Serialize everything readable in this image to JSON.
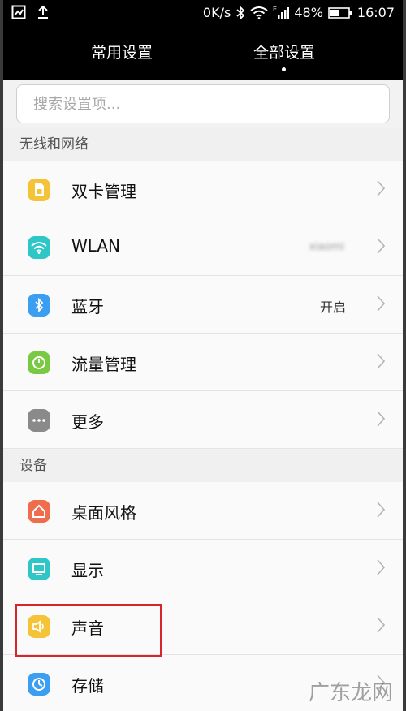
{
  "status_bar": {
    "speed": "0K/s",
    "battery": "48%",
    "time": "16:07",
    "network_type": "E"
  },
  "tabs": [
    {
      "label": "常用设置"
    },
    {
      "label": "全部设置"
    }
  ],
  "search": {
    "placeholder": "搜索设置项..."
  },
  "sections": [
    {
      "title": "无线和网络",
      "items": [
        {
          "label": "双卡管理",
          "value": "",
          "icon": "sim-card-icon",
          "color": "#f4c338"
        },
        {
          "label": "WLAN",
          "value": "xiaomi",
          "icon": "wifi-icon",
          "color": "#2ec6c7"
        },
        {
          "label": "蓝牙",
          "value": "开启",
          "icon": "bluetooth-icon",
          "color": "#3b9ef0"
        },
        {
          "label": "流量管理",
          "value": "",
          "icon": "data-usage-icon",
          "color": "#7ac943"
        },
        {
          "label": "更多",
          "value": "",
          "icon": "more-icon",
          "color": "#8a8a8a"
        }
      ]
    },
    {
      "title": "设备",
      "items": [
        {
          "label": "桌面风格",
          "value": "",
          "icon": "home-icon",
          "color": "#ef6c4d"
        },
        {
          "label": "显示",
          "value": "",
          "icon": "display-icon",
          "color": "#2ec6c7"
        },
        {
          "label": "声音",
          "value": "",
          "icon": "speaker-icon",
          "color": "#f4c338"
        },
        {
          "label": "存储",
          "value": "",
          "icon": "storage-icon",
          "color": "#3b9ef0"
        }
      ]
    }
  ],
  "watermark": "广东龙网"
}
